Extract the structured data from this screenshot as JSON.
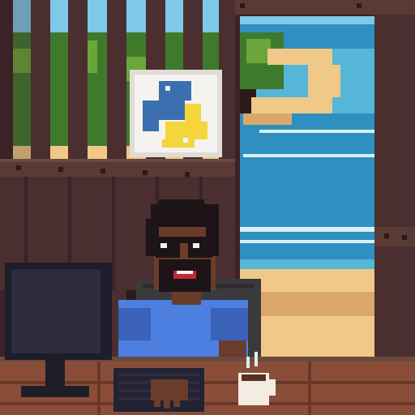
{
  "scene": {
    "kind": "pixel-art illustration",
    "elements": [
      "wooden-hut-wall",
      "doorway-beach-view",
      "python-logo-poster",
      "developer-with-sunglasses",
      "office-chair",
      "computer-monitor",
      "keyboard",
      "coffee-mug",
      "wooden-desk"
    ]
  },
  "colors": {
    "wood_dark": "#3a2226",
    "wood_plank": "#4a2e30",
    "wood_light": "#6b4a3e",
    "beam": "#5a3a34",
    "nail": "#2b1a1c",
    "foliage": "#3f7a2c",
    "foliage_light": "#6aa63a",
    "sky": "#7ec8e8",
    "sea": "#2f8fc0",
    "sea_light": "#56b6d8",
    "surf": "#d8f0f2",
    "sand": "#f0c888",
    "sand_dark": "#d9a868",
    "poster_bg": "#f5f3f0",
    "poster_frame": "#e0dcd6",
    "python_blue": "#3b6fb0",
    "python_yellow": "#f2d63c",
    "skin": "#6a3c2a",
    "skin_dark": "#4a2818",
    "hair": "#1c1416",
    "shirt": "#4d7fe0",
    "shirt_dark": "#3a62b8",
    "chair": "#3a3a3c",
    "monitor": "#1e1e2a",
    "monitor_screen": "#2c2c3e",
    "keyboard": "#222232",
    "desk": "#8a4e38",
    "desk_dark": "#6a3828",
    "mug": "#f4ece2",
    "coffee": "#5a3020"
  }
}
